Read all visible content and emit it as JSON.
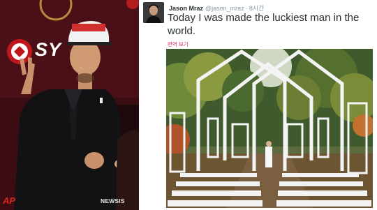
{
  "left_photo": {
    "logo_text": "SY",
    "agency_logo": "AP",
    "watermark": "NEWSIS"
  },
  "tweet": {
    "author": "Jason Mraz",
    "handle": "@jason_mraz",
    "separator": "·",
    "time": "8시간",
    "text": "Today I was made the luckiest man in the world.",
    "translate_label": "번역 보기"
  },
  "colors": {
    "accent": "#e0245e",
    "author": "#292f33",
    "muted": "#8899a6"
  }
}
